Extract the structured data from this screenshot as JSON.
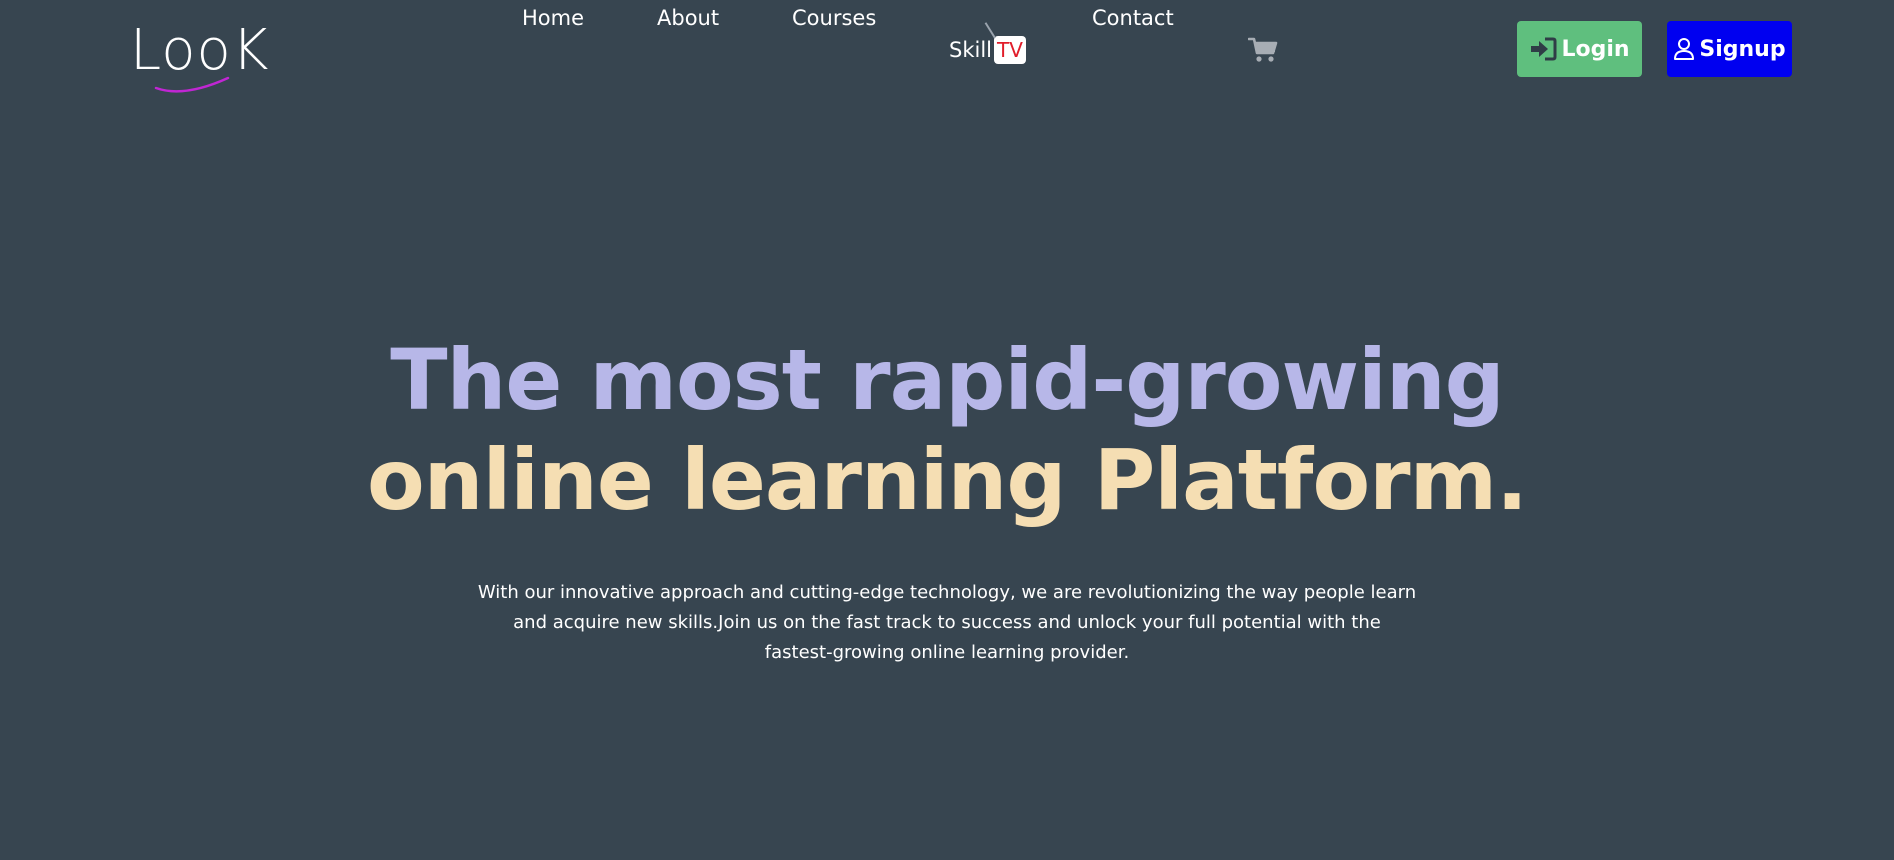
{
  "brand": {
    "logo_text": "LooK",
    "swoosh_color": "#c026d3"
  },
  "nav": {
    "home": "Home",
    "about": "About",
    "courses": "Courses",
    "skill": "Skill",
    "skill_badge": "TV",
    "contact": "Contact",
    "cart_icon": "shopping-cart-icon"
  },
  "auth": {
    "login_label": "Login",
    "login_icon": "sign-in-icon",
    "login_color": "#5fbf7e",
    "signup_label": "Signup",
    "signup_icon": "user-icon",
    "signup_color": "#0000f0"
  },
  "hero": {
    "headline_line1": "The most rapid-growing",
    "headline_line2": "online learning Platform.",
    "line1_color": "#b7b7e8",
    "line2_color": "#f5deb3",
    "description": "With our innovative approach and cutting-edge technology, we are revolutionizing the way people learn and acquire new skills.Join us on the fast track to success and unlock your full potential with the fastest-growing online learning provider."
  },
  "colors": {
    "background": "#374550",
    "tv_badge_text": "#e11d2a"
  }
}
